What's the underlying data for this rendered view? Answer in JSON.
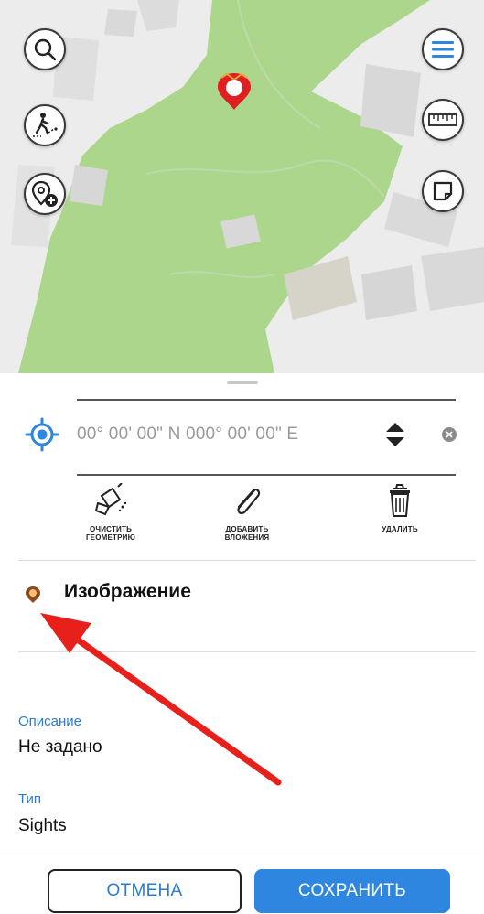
{
  "map": {
    "search_icon": "search-icon",
    "walk_icon": "walking-person-icon",
    "add_place_icon": "add-location-icon",
    "menu_icon": "hamburger-menu-icon",
    "ruler_icon": "ruler-icon",
    "note_icon": "note-icon",
    "pin_color": "#e02020"
  },
  "coordinates": {
    "text": "00° 00' 00\" N 000° 00' 00\" E"
  },
  "tools": [
    {
      "label": "ОЧИСТИТЬ ГЕОМЕТРИЮ",
      "icon": "eraser-icon"
    },
    {
      "label": "ДОБАВИТЬ ВЛОЖЕНИЯ",
      "icon": "paperclip-icon"
    },
    {
      "label": "УДАЛИТЬ",
      "icon": "trash-icon"
    }
  ],
  "layer": {
    "title": "Изображение"
  },
  "fields": {
    "description_label": "Описание",
    "description_value": "Не задано",
    "type_label": "Тип",
    "type_value": "Sights"
  },
  "actions": {
    "cancel": "ОТМЕНА",
    "save": "СОХРАНИТЬ"
  },
  "colors": {
    "accent": "#2f86e0",
    "annotation_arrow": "#e8201c",
    "map_green": "#a9d58a"
  }
}
